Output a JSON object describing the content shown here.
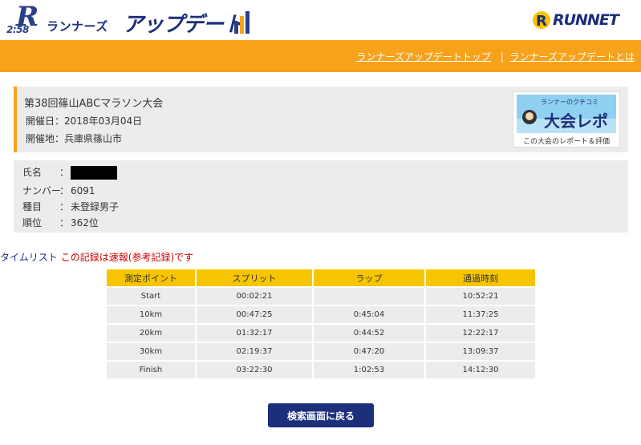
{
  "header": {
    "logo": {
      "mark_text": "2:58",
      "small_text": "ランナーズ",
      "big_text": "アップデート",
      "bar_colors": [
        "#2a3f86",
        "#f7a21b",
        "#2a3f86"
      ]
    },
    "runnet_logo": {
      "text": "RUNNET"
    }
  },
  "nav": {
    "links": [
      {
        "label": "ランナーズアップデートトップ"
      },
      {
        "label": "ランナーズアップデートとは"
      }
    ],
    "separator": "|"
  },
  "event": {
    "name": "第38回篠山ABCマラソン大会",
    "date_label": "開催日",
    "date_value": "2018年03月04日",
    "place_label": "開催地",
    "place_value": "兵庫県篠山市",
    "report_banner": {
      "image_text_top": "ランナーのクチコミ",
      "image_text_main": "大会レポ",
      "caption": "この大会のレポート＆評価"
    }
  },
  "runner": {
    "name_label": "氏名",
    "number_label": "ナンバー",
    "number_value": "6091",
    "category_label": "種目",
    "category_value": "未登録男子",
    "rank_label": "順位",
    "rank_value": "362位",
    "colon": "："
  },
  "timelist": {
    "title": "タイムリスト",
    "note": "この記録は速報(参考記録)です",
    "columns": [
      "測定ポイント",
      "スプリット",
      "ラップ",
      "通過時刻"
    ],
    "rows": [
      [
        "Start",
        "00:02:21",
        "",
        "10:52:21"
      ],
      [
        "10km",
        "00:47:25",
        "0:45:04",
        "11:37:25"
      ],
      [
        "20km",
        "01:32:17",
        "0:44:52",
        "12:22:17"
      ],
      [
        "30km",
        "02:19:37",
        "0:47:20",
        "13:09:37"
      ],
      [
        "Finish",
        "03:22:30",
        "1:02:53",
        "14:12:30"
      ]
    ]
  },
  "actions": {
    "back_label": "検索画面に戻る"
  },
  "colors": {
    "accent_orange": "#f7a21b",
    "header_yellow": "#f7c500",
    "navy": "#1d2f7a",
    "note_red": "#cc0000",
    "box_gray": "#ececec"
  }
}
